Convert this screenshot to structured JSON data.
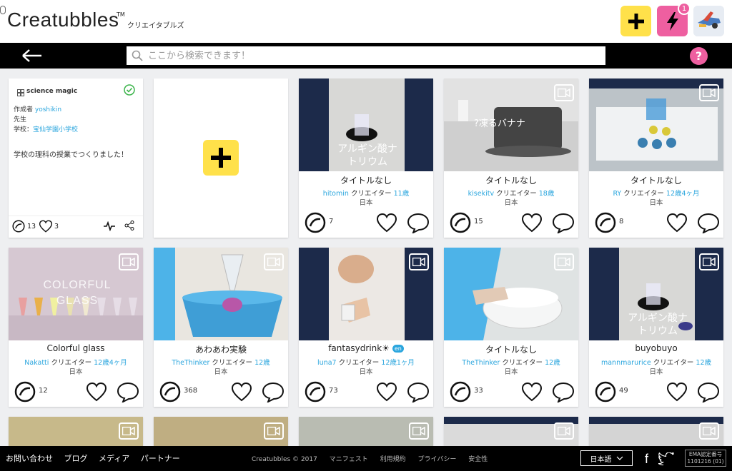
{
  "header": {
    "logo": "Creatubbles",
    "logo_tm": "TM",
    "logo_sub": "クリエイタブルズ",
    "notification_count": "1"
  },
  "search": {
    "placeholder": "ここから検索できます！"
  },
  "help_label": "?",
  "gallery": {
    "title": "science magic",
    "author_label": "作成者",
    "author": "yoshikin",
    "role": "先生",
    "school_label": "学校：",
    "school": "宝仙学園小学校",
    "description": "学校の理科の授業でつくりました！",
    "bubbles": "13",
    "likes": "3"
  },
  "cards": [
    {
      "title": "タイトルなし",
      "user": "hitomin",
      "role": "クリエイター",
      "age": "11歳",
      "country": "日本",
      "bubbles": "7",
      "overlay": "アルギン酸ナトリウム"
    },
    {
      "title": "タイトルなし",
      "user": "kisekitv",
      "role": "クリエイター",
      "age": "18歳",
      "country": "日本",
      "bubbles": "15",
      "overlay": "?凍るバナナ"
    },
    {
      "title": "タイトルなし",
      "user": "RY",
      "role": "クリエイター",
      "age": "12歳4ヶ月",
      "country": "日本",
      "bubbles": "8"
    },
    {
      "title": "Colorful glass",
      "user": "Nakatti",
      "role": "クリエイター",
      "age": "12歳4ヶ月",
      "country": "日本",
      "bubbles": "12",
      "overlay": "COLORFUL GLASS"
    },
    {
      "title": "あわあわ実験",
      "user": "TheThinker",
      "role": "クリエイター",
      "age": "12歳",
      "country": "日本",
      "bubbles": "368"
    },
    {
      "title": "fantasydrink☀",
      "title_badge": "en",
      "user": "luna7",
      "role": "クリエイター",
      "age": "12歳1ヶ月",
      "country": "日本",
      "bubbles": "73"
    },
    {
      "title": "タイトルなし",
      "user": "TheThinker",
      "role": "クリエイター",
      "age": "12歳",
      "country": "日本",
      "bubbles": "33"
    },
    {
      "title": "buyobuyo",
      "user": "mannmarurice",
      "role": "クリエイター",
      "age": "12歳",
      "country": "日本",
      "bubbles": "49",
      "overlay": "アルギン酸ナトリウム"
    }
  ],
  "footer": {
    "links": [
      "お問い合わせ",
      "ブログ",
      "メディア",
      "パートナー"
    ],
    "copyright": "Creatubbles © 2017",
    "center_links": [
      "マニフェスト",
      "利用規約",
      "プライバシー",
      "安全性"
    ],
    "language": "日本語",
    "ema_line1": "EMA認定番号",
    "ema_line2": "1101216 (01)"
  },
  "colors": {
    "yellow": "#ffe14a",
    "pink": "#ee5fa0",
    "link": "#2ba6de",
    "navy": "#1c2a4a"
  }
}
